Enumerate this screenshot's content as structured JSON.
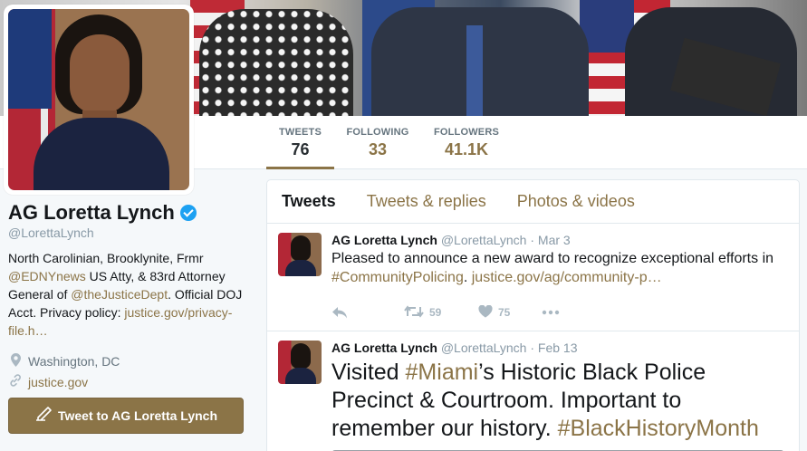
{
  "profile": {
    "name": "AG Loretta Lynch",
    "handle": "@LorettaLynch",
    "bio_parts": {
      "t1": "North Carolinian, Brooklynite, Frmr ",
      "link1": "@EDNYnews",
      "t2": " US Atty, & 83rd Attorney General of ",
      "link2": "@theJusticeDept",
      "t3": ". Official DOJ Acct. Privacy policy: ",
      "link3": "justice.gov/privacy-file.h…"
    },
    "location": "Washington, DC",
    "website": "justice.gov",
    "tweet_to_label": "Tweet to AG Loretta Lynch"
  },
  "stats": {
    "tweets_label": "TWEETS",
    "tweets_value": "76",
    "following_label": "FOLLOWING",
    "following_value": "33",
    "followers_label": "FOLLOWERS",
    "followers_value": "41.1K"
  },
  "tabs": {
    "tweets": "Tweets",
    "replies": "Tweets & replies",
    "media": "Photos & videos"
  },
  "tweets": [
    {
      "name": "AG Loretta Lynch",
      "handle": "@LorettaLynch",
      "date": "· Mar 3",
      "text1": "Pleased to announce a new award to recognize exceptional efforts in ",
      "hashtag": "#CommunityPolicing",
      "text2": ".  ",
      "url": "justice.gov/ag/community-p…",
      "retweets": "59",
      "likes": "75"
    },
    {
      "name": "AG Loretta Lynch",
      "handle": "@LorettaLynch",
      "date": "· Feb 13",
      "text1": "Visited ",
      "hashtag": "#Miami",
      "text2": "’s Historic Black Police Precinct & Courtroom. Important to remember our history. ",
      "hashtag2": "#BlackHistoryMonth"
    }
  ],
  "colors": {
    "accent": "#8b7447",
    "verified": "#1da1f2",
    "muted": "#8899a6"
  },
  "icons": {
    "verified": "verified-badge-icon",
    "location": "location-pin-icon",
    "link": "link-icon",
    "quill": "quill-icon",
    "reply": "reply-icon",
    "retweet": "retweet-icon",
    "like": "heart-icon",
    "more": "more-dots-icon"
  }
}
